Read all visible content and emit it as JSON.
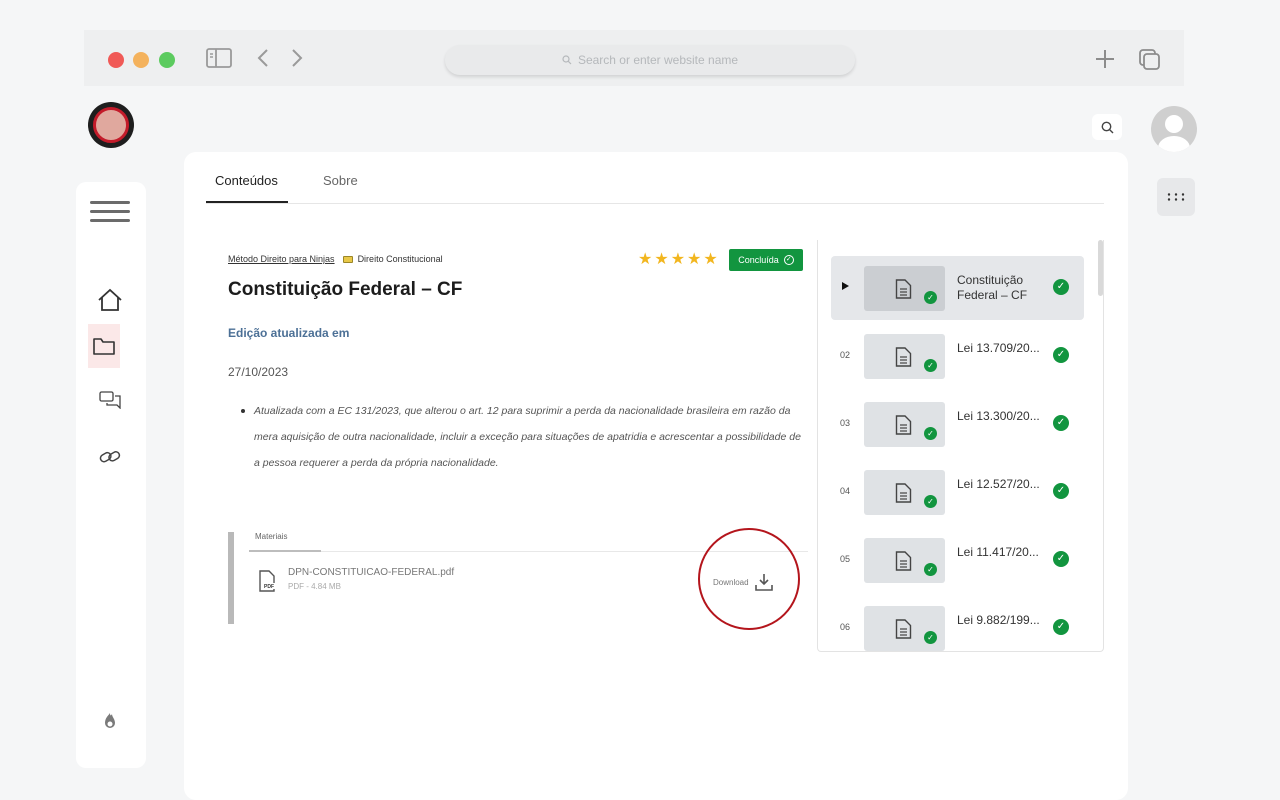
{
  "browser": {
    "address_placeholder": "Search or enter website name"
  },
  "tabs": [
    {
      "label": "Conteúdos"
    },
    {
      "label": "Sobre"
    }
  ],
  "breadcrumb": {
    "course": "Método Direito para Ninjas",
    "module": "Direito Constitucional"
  },
  "rating": {
    "stars": 5
  },
  "status_badge": "Concluída",
  "content": {
    "title": "Constituição Federal – CF",
    "edition_label": "Edição atualizada em",
    "date": "27/10/2023",
    "note": "Atualizada com a EC 131/2023, que alterou o art. 12 para suprimir a perda da nacionalidade brasileira em razão da mera aquisição de outra nacionalidade, incluir a exceção para situações de apatridia e acrescentar a possibilidade de a pessoa requerer a perda da própria nacionalidade."
  },
  "materials": {
    "tab_label": "Materiais",
    "file_name": "DPN-CONSTITUICAO-FEDERAL.pdf",
    "file_meta": "PDF - 4.84 MB",
    "download_label": "Download"
  },
  "playlist": [
    {
      "num": "",
      "title": "Constituição Federal – CF",
      "active": true
    },
    {
      "num": "02",
      "title": "Lei 13.709/20...",
      "active": false
    },
    {
      "num": "03",
      "title": "Lei 13.300/20...",
      "active": false
    },
    {
      "num": "04",
      "title": "Lei 12.527/20...",
      "active": false
    },
    {
      "num": "05",
      "title": "Lei 11.417/20...",
      "active": false
    },
    {
      "num": "06",
      "title": "Lei 9.882/199...",
      "active": false
    }
  ],
  "colors": {
    "accent_green": "#12953f",
    "highlight_red": "#b4151c",
    "edition_blue": "#4c7096"
  }
}
